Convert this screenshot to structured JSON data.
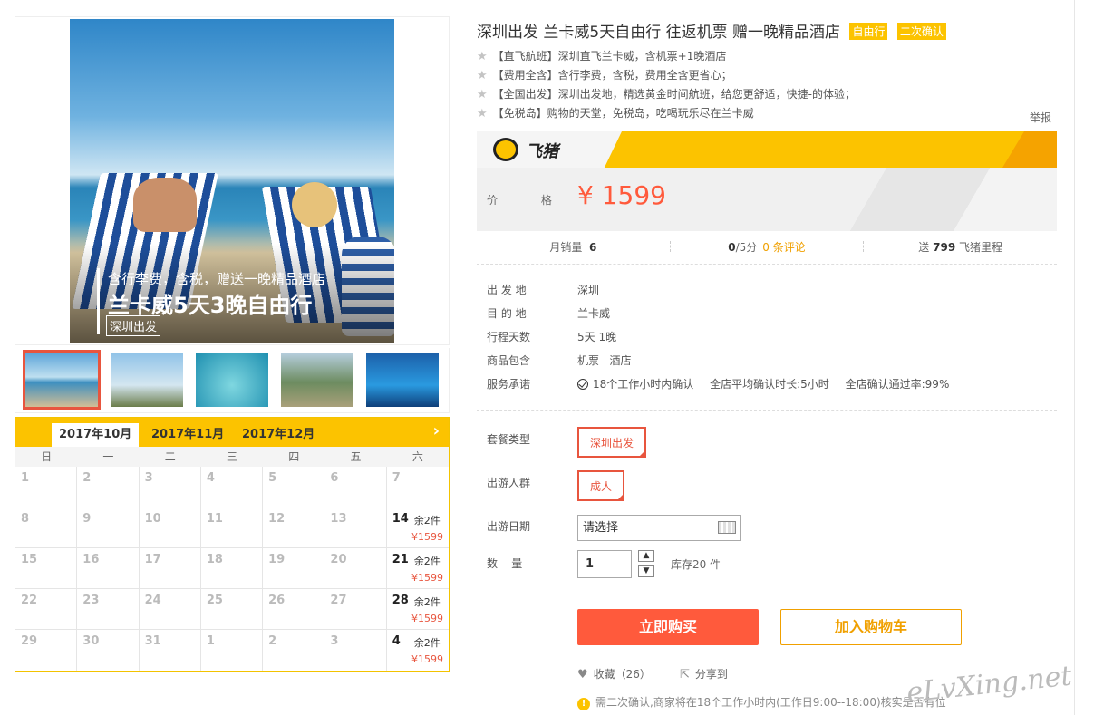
{
  "gallery": {
    "hero_subtitle": "含行李费，含税，赠送一晚精品酒店",
    "hero_title": "兰卡威5天3晚自由行",
    "hero_tag": "深圳出发"
  },
  "calendar": {
    "tabs": [
      "2017年10月",
      "2017年11月",
      "2017年12月"
    ],
    "next_icon": "›",
    "weekdays": [
      "日",
      "一",
      "二",
      "三",
      "四",
      "五",
      "六"
    ],
    "cells": [
      {
        "day": "1"
      },
      {
        "day": "2"
      },
      {
        "day": "3"
      },
      {
        "day": "4"
      },
      {
        "day": "5"
      },
      {
        "day": "6"
      },
      {
        "day": "7"
      },
      {
        "day": "8"
      },
      {
        "day": "9"
      },
      {
        "day": "10"
      },
      {
        "day": "11"
      },
      {
        "day": "12"
      },
      {
        "day": "13"
      },
      {
        "day": "14",
        "stock": "余2件",
        "price": "¥1599"
      },
      {
        "day": "15"
      },
      {
        "day": "16"
      },
      {
        "day": "17"
      },
      {
        "day": "18"
      },
      {
        "day": "19"
      },
      {
        "day": "20"
      },
      {
        "day": "21",
        "stock": "余2件",
        "price": "¥1599"
      },
      {
        "day": "22"
      },
      {
        "day": "23"
      },
      {
        "day": "24"
      },
      {
        "day": "25"
      },
      {
        "day": "26"
      },
      {
        "day": "27"
      },
      {
        "day": "28",
        "stock": "余2件",
        "price": "¥1599"
      },
      {
        "day": "29"
      },
      {
        "day": "30"
      },
      {
        "day": "31"
      },
      {
        "day": "1"
      },
      {
        "day": "2"
      },
      {
        "day": "3"
      },
      {
        "day": "4",
        "stock": "余2件",
        "price": "¥1599"
      }
    ]
  },
  "product": {
    "title": "深圳出发 兰卡威5天自由行 往返机票 赠一晚精品酒店",
    "badges": [
      "自由行",
      "二次确认"
    ],
    "highlights": [
      "【直飞航班】深圳直飞兰卡威，含机票+1晚酒店",
      "【费用全含】含行李费，含税，费用全含更省心；",
      "【全国出发】深圳出发地，精选黄金时间航班，给您更舒适，快捷-的体验；",
      "【免税岛】购物的天堂，免税岛，吃喝玩乐尽在兰卡威"
    ],
    "report": "举报"
  },
  "price_box": {
    "logo_text": "飞猪",
    "label": "价 格",
    "value": "¥ 1599"
  },
  "stats": {
    "monthly_sales_label": "月销量",
    "monthly_sales_value": "6",
    "score_value": "0",
    "score_suffix": "/5分",
    "reviews_link": "0 条评论",
    "miles_prefix": "送",
    "miles_value": "799",
    "miles_suffix": "飞猪里程"
  },
  "info": {
    "rows": [
      {
        "key": "出 发 地",
        "val": "深圳"
      },
      {
        "key": "目 的 地",
        "val": "兰卡威"
      },
      {
        "key": "行程天数",
        "val": "5天 1晚"
      },
      {
        "key": "商品包含",
        "val": "机票   酒店"
      }
    ],
    "service_key": "服务承诺",
    "service_items": [
      "18个工作小时内确认",
      "全店平均确认时长:5小时",
      "全店确认通过率:99%"
    ]
  },
  "options": {
    "package_label": "套餐类型",
    "package_value": "深圳出发",
    "crowd_label": "出游人群",
    "crowd_value": "成人",
    "date_label": "出游日期",
    "date_placeholder": "请选择",
    "qty_label": "数    量",
    "qty_value": "1",
    "stock": "库存20 件"
  },
  "actions": {
    "buy": "立即购买",
    "cart": "加入购物车",
    "favorite": "收藏（26）",
    "share": "分享到"
  },
  "notice": "需二次确认,商家将在18个工作小时内(工作日9:00--18:00)核实是否有位",
  "watermark": "eLvXing.net"
}
